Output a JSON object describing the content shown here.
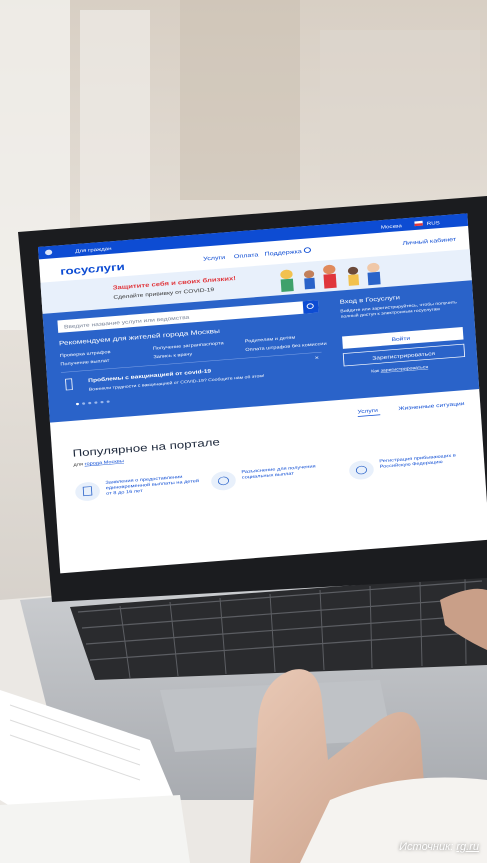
{
  "photo_credit": {
    "prefix": "Источник: ",
    "link": "rg.ru"
  },
  "portal": {
    "logo": "госуслуги",
    "top_nav": {
      "for_citizens": "Для граждан",
      "city": "Москва",
      "lang": "RUS",
      "nav_items": [
        "Услуги",
        "Оплата",
        "Поддержка"
      ],
      "cabinet": "Личный кабинет"
    },
    "banner": {
      "title": "Защитите себя и своих близких!",
      "subtitle": "Сделайте прививку от COVID-19"
    },
    "search": {
      "placeholder": "Введите название услуги или ведомства"
    },
    "recommend": {
      "title": "Рекомендуем для жителей города Москвы",
      "links": [
        "Проверка штрафов",
        "Получение загранпаспорта",
        "Родителям и детям",
        "Получение выплат",
        "Запись к врачу",
        "Оплата штрафов без комиссии"
      ]
    },
    "login": {
      "title": "Вход в Госуслуги",
      "text": "Войдите или зарегистрируйтесь, чтобы получить полный доступ к электронным госуслугам",
      "login_button": "Войти",
      "register_button": "Зарегистрироваться",
      "help_prefix": "Как ",
      "help_link": "зарегистрироваться"
    },
    "notice": {
      "title": "Проблемы с вакцинацией от covid-19",
      "text": "Возникли трудности с вакцинацией от COVID-19? Сообщите нам об этом!"
    },
    "tabs": [
      "Услуги",
      "Жизненные ситуации"
    ],
    "popular": {
      "title": "Популярное на портале",
      "subtitle_prefix": "для ",
      "subtitle_link": "города Москвы",
      "cards": [
        "Заявления о предоставлении единовременной выплаты на детей от 8 до 16 лет",
        "Разъяснение для получения социальных выплат",
        "Регистрация прибывающих в Российскую Федерацию"
      ]
    }
  },
  "colors": {
    "primary": "#0d4cd3",
    "panel": "#2a63c9",
    "screen_bg": "#ffffff",
    "accent_red": "#e0363c",
    "banner_bg": "#e8f0fb"
  }
}
